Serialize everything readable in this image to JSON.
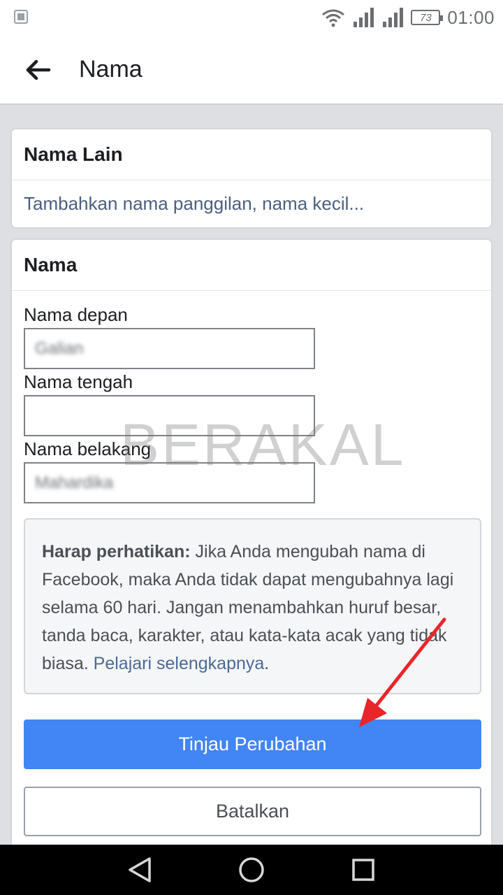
{
  "status_bar": {
    "battery_level": "73",
    "time": "01:00",
    "icons": [
      "gallery-icon",
      "wifi-icon",
      "signal-icon",
      "signal-icon",
      "battery-icon"
    ]
  },
  "header": {
    "title": "Nama",
    "back_icon": "arrow-left-icon"
  },
  "alt_names_section": {
    "title": "Nama Lain",
    "add_link": "Tambahkan nama panggilan, nama kecil..."
  },
  "name_section": {
    "title": "Nama",
    "fields": [
      {
        "label": "Nama depan",
        "value": "Galian"
      },
      {
        "label": "Nama tengah",
        "value": ""
      },
      {
        "label": "Nama belakang",
        "value": "Mahardika"
      }
    ],
    "notice": {
      "bold_prefix": "Harap perhatikan:",
      "text": " Jika Anda mengubah nama di Facebook, maka Anda tidak dapat mengubahnya lagi selama 60 hari. Jangan menambahkan huruf besar, tanda baca, karakter, atau kata-kata acak yang tidak biasa. ",
      "link": "Pelajari selengkapnya",
      "suffix": "."
    },
    "review_button": "Tinjau Perubahan",
    "cancel_button": "Batalkan"
  },
  "watermark": "BERAKAL",
  "colors": {
    "primary": "#4285f4",
    "link": "#4b6a96",
    "annotation_arrow": "#e8262a"
  },
  "nav_bar": {
    "icons": [
      "back-triangle-icon",
      "home-circle-icon",
      "recents-square-icon"
    ]
  }
}
